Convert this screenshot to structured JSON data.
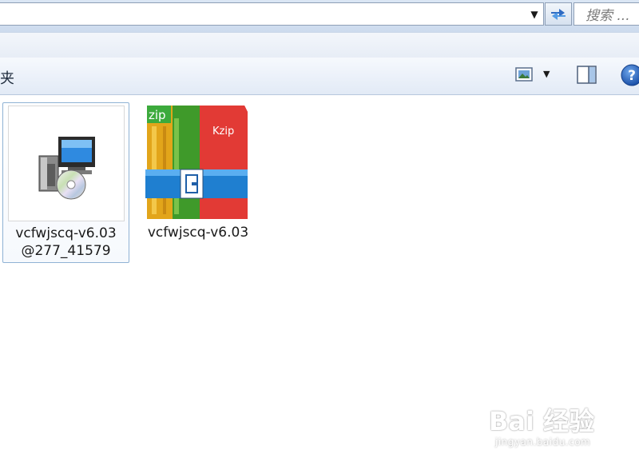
{
  "address_bar": {
    "search_placeholder": "搜索 ..."
  },
  "toolbar": {
    "label": "夹"
  },
  "files": [
    {
      "name_line1": "vcfwjscq-v6.03",
      "name_line2": "@277_41579",
      "icon": "installer-cd-icon",
      "selected": true
    },
    {
      "name_line1": "vcfwjscq-v6.03",
      "icon": "kzip-archive-icon",
      "icon_text_top": "zip",
      "icon_text_side": "Kzip",
      "selected": false
    }
  ],
  "watermark": {
    "brand": "Bai 经验",
    "url": "jingyan.baidu.com"
  },
  "colors": {
    "accent": "#3a7bc8",
    "selection_border": "#8fb2d4",
    "zip_red": "#d8282b",
    "zip_green": "#5aa82a",
    "zip_yellow": "#e8b21a",
    "zip_blue": "#1f84d4"
  }
}
